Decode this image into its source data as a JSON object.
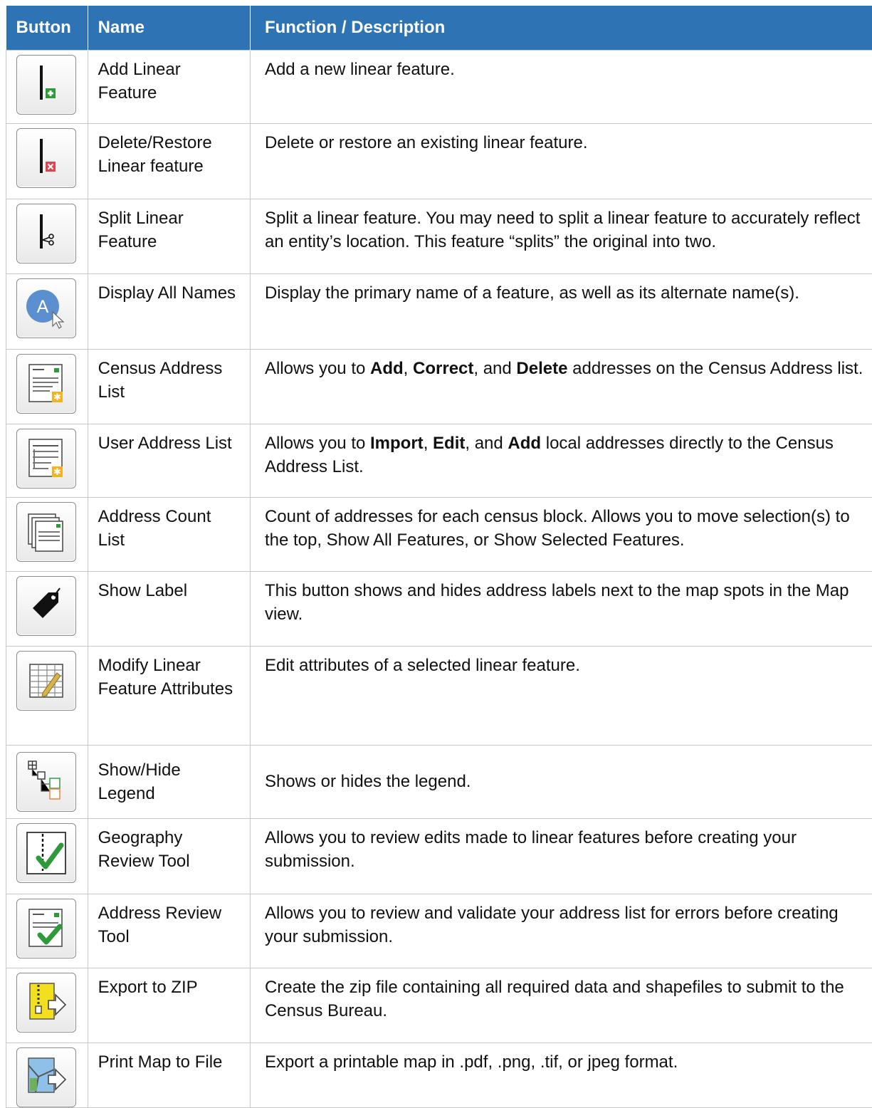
{
  "header": {
    "col_button": "Button",
    "col_name": "Name",
    "col_desc": "Function / Description"
  },
  "rows": [
    {
      "icon": "add-linear-feature-icon",
      "name": "Add Linear Feature",
      "desc": "Add a new linear feature."
    },
    {
      "icon": "delete-linear-feature-icon",
      "name": "Delete/Restore Linear feature",
      "desc": "Delete or restore an existing linear feature."
    },
    {
      "icon": "split-linear-feature-icon",
      "name": "Split Linear Feature",
      "desc": "Split a linear feature. You may need to split a linear feature to accurately reflect an entity’s location. This feature “splits” the original into two."
    },
    {
      "icon": "display-all-names-icon",
      "name": "Display All Names",
      "desc": "Display the primary name of a feature, as well as its alternate name(s)."
    },
    {
      "icon": "census-address-list-icon",
      "name": "Census Address List",
      "desc_pre": "Allows you to ",
      "b1": "Add",
      "sep1": ", ",
      "b2": "Correct",
      "sep2": ", and ",
      "b3": "Delete",
      "desc_post": " addresses on the Census Address list."
    },
    {
      "icon": "user-address-list-icon",
      "name": "User Address List",
      "desc_pre": "Allows you to ",
      "b1": "Import",
      "sep1": ", ",
      "b2": "Edit",
      "sep2": ", and ",
      "b3": "Add",
      "desc_post": " local addresses directly to the Census Address List."
    },
    {
      "icon": "address-count-list-icon",
      "name": "Address Count List",
      "desc": "Count of addresses for each census block. Allows you to move selection(s) to the top, Show All Features, or Show Selected Features."
    },
    {
      "icon": "tag-icon",
      "name": "Show Label",
      "desc": "This button shows and hides address labels next to the map spots in the Map view."
    },
    {
      "icon": "table-pencil-icon",
      "name": "Modify Linear Feature Attributes",
      "desc": "Edit attributes of a selected linear feature."
    },
    {
      "icon": "legend-icon",
      "name": "Show/Hide Legend",
      "desc": "Shows or hides the legend."
    },
    {
      "icon": "geography-review-icon",
      "name": "Geography Review Tool",
      "desc": "Allows you to review edits made to linear features before creating your submission."
    },
    {
      "icon": "address-review-icon",
      "name": "Address Review Tool",
      "desc": "Allows you to review and validate your address list for errors before creating your submission."
    },
    {
      "icon": "zip-export-icon",
      "name": "Export to ZIP",
      "desc": "Create the zip file containing all required data and shapefiles to submit to the Census Bureau."
    },
    {
      "icon": "print-map-icon",
      "name": "Print Map to File",
      "desc": "Export a printable map in .pdf, .png, .tif, or jpeg format."
    }
  ],
  "colors": {
    "header_bg": "#2E74B5",
    "header_text": "#FFFFFF",
    "grid": "#C8C8C8"
  }
}
